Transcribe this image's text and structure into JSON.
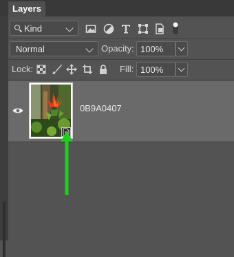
{
  "panel": {
    "tab_label": "Layers"
  },
  "filter": {
    "kind_label": "Kind",
    "icons": [
      "image-filter-icon",
      "adjustment-filter-icon",
      "type-filter-icon",
      "shape-filter-icon",
      "smart-object-filter-icon",
      "filter-toggle-icon"
    ]
  },
  "blend": {
    "mode": "Normal",
    "opacity_label": "Opacity:",
    "opacity_value": "100%"
  },
  "lock": {
    "label": "Lock:",
    "fill_label": "Fill:",
    "fill_value": "100%"
  },
  "layer": {
    "name": "0B9A0407",
    "visible": true,
    "is_smart_object": true
  },
  "colors": {
    "arrow": "#22cc22",
    "selected_row": "#6a6a6a",
    "panel_bg": "#535353"
  }
}
